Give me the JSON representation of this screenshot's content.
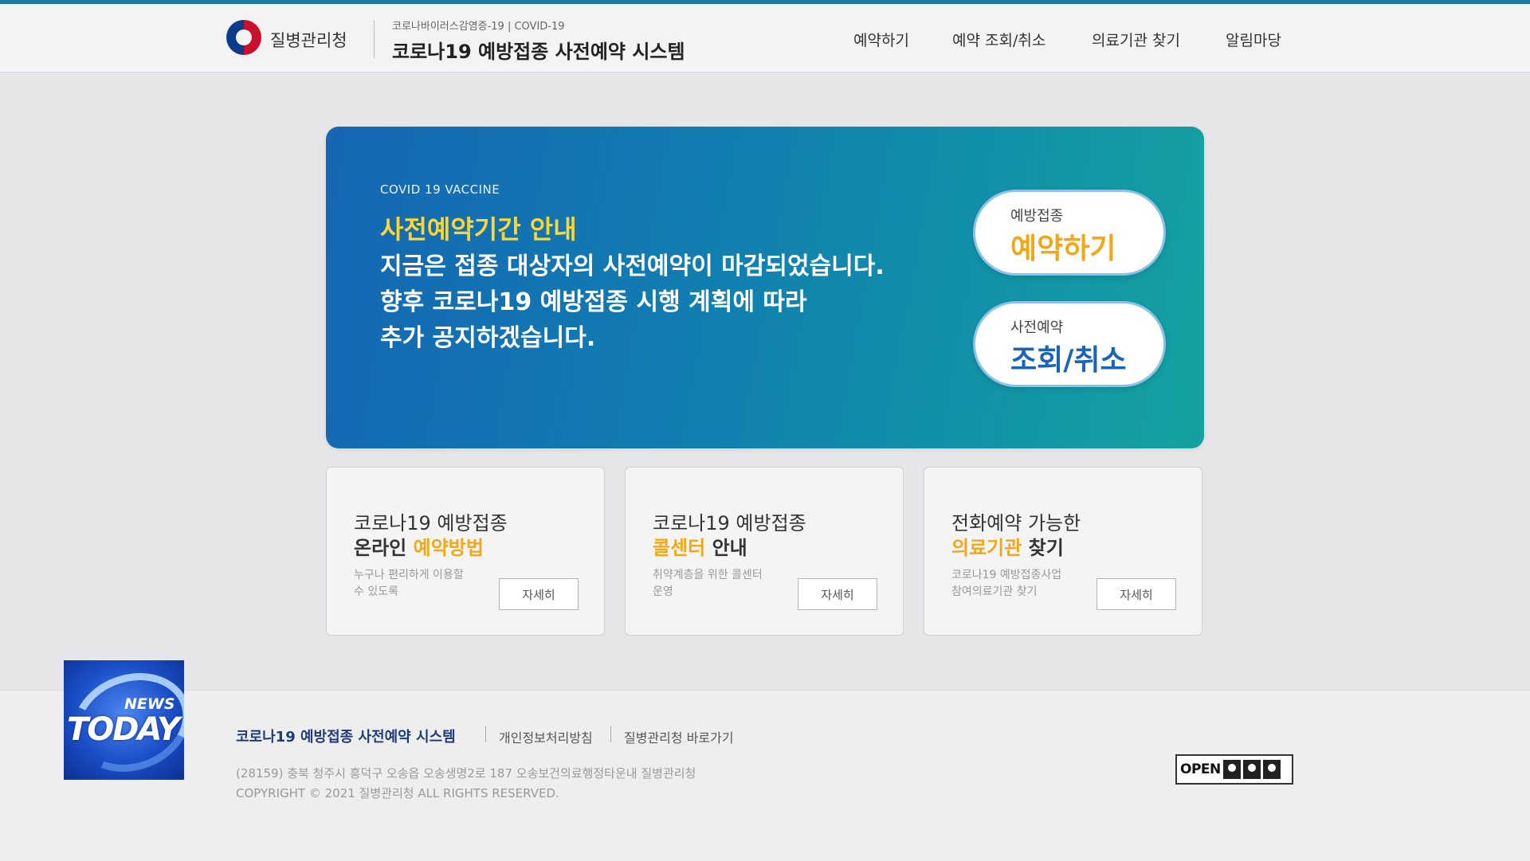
{
  "header": {
    "org_name": "질병관리청",
    "system_subtitle": "코로나바이러스감염증-19 | COVID-19",
    "system_title": "코로나19 예방접종 사전예약 시스템",
    "nav": [
      {
        "label": "예약하기"
      },
      {
        "label": "예약 조회/취소"
      },
      {
        "label": "의료기관 찾기"
      },
      {
        "label": "알림마당"
      }
    ]
  },
  "hero": {
    "kicker": "COVID 19 VACCINE",
    "heading": "사전예약기간 안내",
    "lines": [
      "지금은 접종 대상자의 사전예약이 마감되었습니다.",
      "향후 코로나19 예방접종 시행 계획에 따라",
      "추가 공지하겠습니다."
    ],
    "buttons": [
      {
        "small": "예방접종",
        "big": "예약하기",
        "color": "#f0a818"
      },
      {
        "small": "사전예약",
        "big": "조회/취소",
        "color": "#1a63b8"
      }
    ]
  },
  "cards": [
    {
      "line1": "코로나19 예방접종",
      "line2_dark": "온라인 ",
      "line2_accent": "예약방법",
      "desc": "누구나 편리하게 이용할 수 있도록",
      "button": "자세히"
    },
    {
      "line1": "코로나19 예방접종",
      "line2_accent": "콜센터",
      "line2_dark": " 안내",
      "desc": "취약계층을 위한 콜센터 운영",
      "button": "자세히"
    },
    {
      "line1": "전화예약 가능한",
      "line2_accent": "의료기관",
      "line2_dark": " 찾기",
      "desc": "코로나19 예방접종사업 참여의료기관 찾기",
      "button": "자세히"
    }
  ],
  "footer": {
    "title": "코로나19 예방접종 사전예약 시스템",
    "links": [
      "개인정보처리방침",
      "질병관리청 바로가기"
    ],
    "address": "(28159) 충북 청주시 흥덕구 오송읍 오송생명2로 187 오송보건의료행정타운내 질병관리청",
    "copyright": "COPYRIGHT © 2021 질병관리청 ALL RIGHTS RESERVED.",
    "badge": "OPEN"
  },
  "overlay": {
    "news": "NEWS",
    "today": "TODAY"
  },
  "colors": {
    "accent_yellow": "#f0a818",
    "hero_blue": "#1566b4",
    "hero_teal": "#14a3a0",
    "title_navy": "#1e3c78"
  }
}
